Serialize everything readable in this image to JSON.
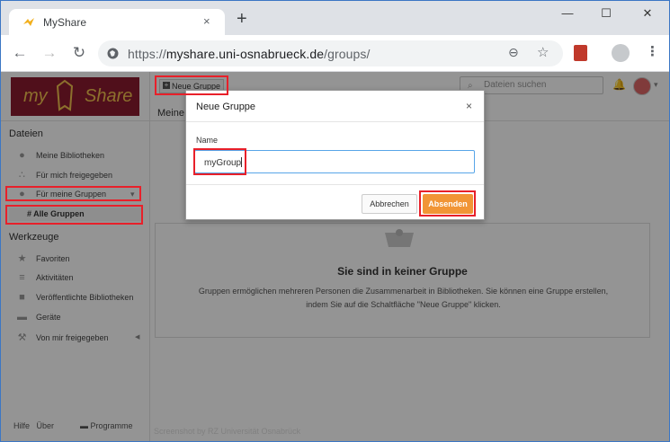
{
  "browser": {
    "tab_title": "MyShare",
    "tab_close": "×",
    "new_tab": "+",
    "url_scheme": "https://",
    "url_host": "myshare.uni-osnabrueck.de",
    "url_path": "/groups/"
  },
  "app": {
    "logo_left": "my",
    "logo_right": "Share",
    "new_group_button": "Neue Gruppe",
    "search_placeholder": "Dateien suchen",
    "page_heading_partial": "Meine",
    "sidebar": {
      "files_heading": "Dateien",
      "files_items": [
        {
          "label": "Meine Bibliotheken",
          "icon": "person-icon"
        },
        {
          "label": "Für mich freigegeben",
          "icon": "share-icon"
        },
        {
          "label": "Für meine Gruppen",
          "icon": "group-icon"
        }
      ],
      "all_groups": "# Alle Gruppen",
      "tools_heading": "Werkzeuge",
      "tools_items": [
        {
          "label": "Favoriten",
          "icon": "star-icon"
        },
        {
          "label": "Aktivitäten",
          "icon": "activity-icon"
        },
        {
          "label": "Veröffentlichte Bibliotheken",
          "icon": "book-icon"
        },
        {
          "label": "Geräte",
          "icon": "monitor-icon"
        },
        {
          "label": "Von mir freigegeben",
          "icon": "wrench-icon"
        }
      ],
      "footer_help": "Hilfe",
      "footer_about": "Über",
      "footer_programs": "Programme"
    },
    "empty_state": {
      "title": "Sie sind in keiner Gruppe",
      "description": "Gruppen ermöglichen mehreren Personen die Zusammenarbeit in Bibliotheken. Sie können eine Gruppe erstellen, indem Sie auf die Schaltfläche \"Neue Gruppe\" klicken."
    },
    "watermark": "Screenshot by RZ Universität Osnabrück"
  },
  "dialog": {
    "title": "Neue Gruppe",
    "close": "×",
    "name_label": "Name",
    "name_value": "myGroup",
    "cancel_label": "Abbrechen",
    "submit_label": "Absenden"
  },
  "colors": {
    "logo_bg": "#8b1a30",
    "submit_bg": "#f19536",
    "highlight": "#e8202a",
    "input_focus": "#58a5e8"
  }
}
